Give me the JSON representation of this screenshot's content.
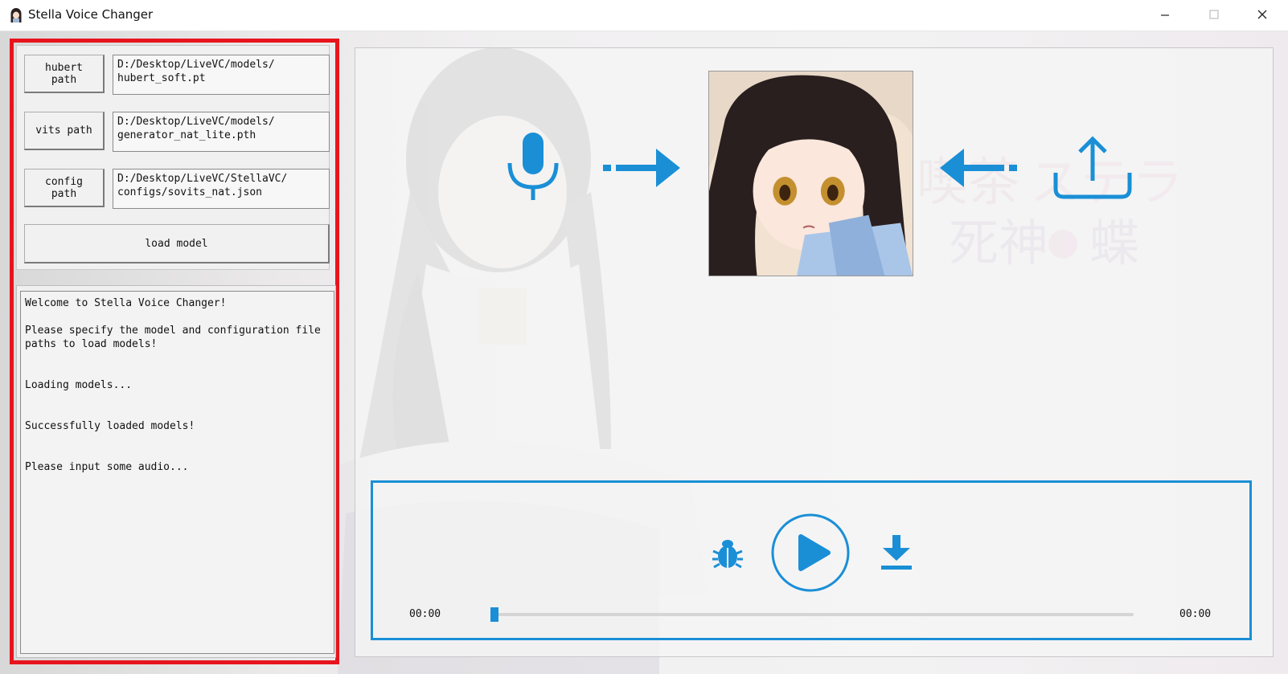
{
  "window": {
    "title": "Stella Voice Changer"
  },
  "model_config": {
    "hubert": {
      "button_label": "hubert path",
      "path_value": "D:/Desktop/LiveVC/models/\nhubert_soft.pt"
    },
    "vits": {
      "button_label": "vits path",
      "path_value": "D:/Desktop/LiveVC/models/\ngenerator_nat_lite.pth"
    },
    "config": {
      "button_label": "config path",
      "path_value": "D:/Desktop/LiveVC/StellaVC/\nconfigs/sovits_nat.json"
    },
    "load_button_label": "load model"
  },
  "log": {
    "text": "Welcome to Stella Voice Changer!\n\nPlease specify the model and configuration file paths to load models!\n\n\nLoading models...\n\n\nSuccessfully loaded models!\n\n\nPlease input some audio..."
  },
  "icons": {
    "input": "microphone-icon",
    "upload": "upload-icon",
    "debug": "bug-icon",
    "play": "play-icon",
    "download": "download-icon"
  },
  "player": {
    "current_time": "00:00",
    "total_time": "00:00",
    "progress": 0
  },
  "colors": {
    "accent": "#1a8fd6",
    "highlight_frame": "#e8141d"
  }
}
